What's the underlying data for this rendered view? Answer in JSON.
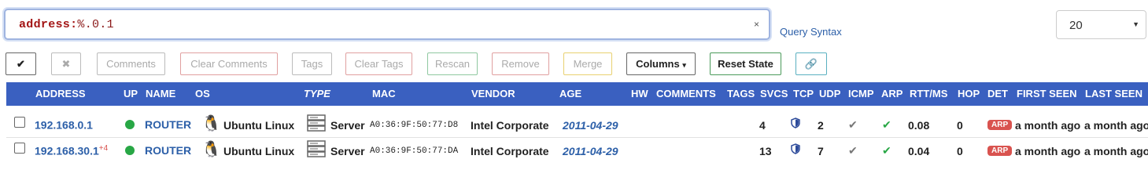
{
  "search": {
    "prefix": "address:",
    "value": "%.0.1",
    "clear": "×"
  },
  "query_syntax_label": "Query Syntax",
  "page_size": {
    "value": "20"
  },
  "toolbar": {
    "select_all": "✔",
    "deselect": "✖",
    "comments": "Comments",
    "clear_comments": "Clear Comments",
    "tags": "Tags",
    "clear_tags": "Clear Tags",
    "rescan": "Rescan",
    "remove": "Remove",
    "merge": "Merge",
    "columns": "Columns",
    "columns_caret": "▾",
    "reset_state": "Reset State",
    "link": "🔗"
  },
  "columns": [
    "ADDRESS",
    "UP",
    "NAME",
    "OS",
    "TYPE",
    "MAC",
    "VENDOR",
    "AGE",
    "HW",
    "COMMENTS",
    "TAGS",
    "SVCS",
    "TCP",
    "UDP",
    "ICMP",
    "ARP",
    "RTT/MS",
    "HOP",
    "DET",
    "FIRST SEEN",
    "LAST SEEN"
  ],
  "rows": [
    {
      "address": "192.168.0.1",
      "address_extra": "",
      "name": "ROUTER",
      "os": "Ubuntu Linux",
      "type": "Server",
      "mac": "A0:36:9F:50:77:D8",
      "vendor": "Intel Corporate",
      "age": "2011-04-29",
      "svcs": "4",
      "udp": "2",
      "rtt": "0.08",
      "hop": "0",
      "det": "ARP",
      "first_seen": "a month ago",
      "last_seen": "a month ago"
    },
    {
      "address": "192.168.30.1",
      "address_extra": "+4",
      "name": "ROUTER",
      "os": "Ubuntu Linux",
      "type": "Server",
      "mac": "A0:36:9F:50:77:DA",
      "vendor": "Intel Corporate",
      "age": "2011-04-29",
      "svcs": "13",
      "udp": "7",
      "rtt": "0.04",
      "hop": "0",
      "det": "ARP",
      "first_seen": "a month ago",
      "last_seen": "a month ago"
    }
  ],
  "colors": {
    "header_bg": "#3a60c0",
    "link": "#2c5fa8",
    "up": "#28a745",
    "arp_badge": "#d9534f"
  }
}
